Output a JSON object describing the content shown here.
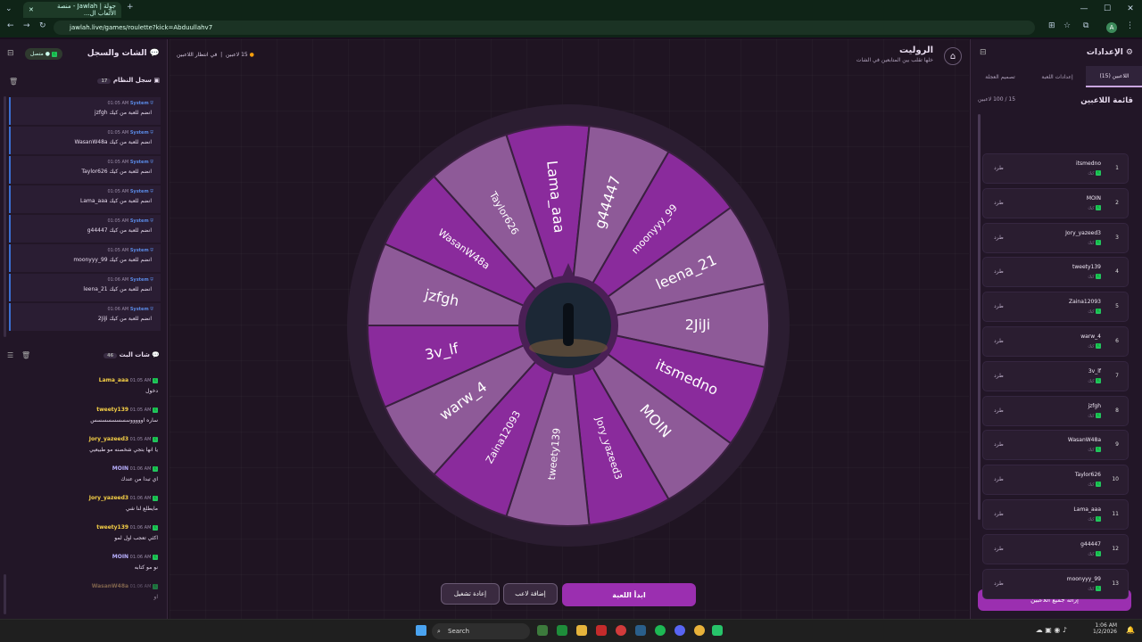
{
  "browser": {
    "tab_title": "جولة | Jawlah - منصة الألعاب ال...",
    "url": "jawlah.live/games/roulette?kick=Abduullahv7",
    "avatar_letter": "A"
  },
  "left": {
    "title": "الشات والسجل",
    "status": "متصل",
    "system_log_title": "سجل النظام",
    "system_log_count": "17",
    "system_log": [
      {
        "sender": "System",
        "time": "01:05 AM",
        "text": "jzfgh انضم للعبة من كيك"
      },
      {
        "sender": "System",
        "time": "01:05 AM",
        "text": "WasanW48a انضم للعبة من كيك"
      },
      {
        "sender": "System",
        "time": "01:05 AM",
        "text": "Taylor626 انضم للعبة من كيك"
      },
      {
        "sender": "System",
        "time": "01:05 AM",
        "text": "Lama_aaa انضم للعبة من كيك"
      },
      {
        "sender": "System",
        "time": "01:05 AM",
        "text": "g44447 انضم للعبة من كيك"
      },
      {
        "sender": "System",
        "time": "01:05 AM",
        "text": "moonyyy_99 انضم للعبة من كيك"
      },
      {
        "sender": "System",
        "time": "01:06 AM",
        "text": "leena_21 انضم للعبة من كيك"
      },
      {
        "sender": "System",
        "time": "01:06 AM",
        "text": "2JiJi انضم للعبة من كيك"
      }
    ],
    "live_chat_title": "شات البث",
    "live_chat_count": "46",
    "live_chat": [
      {
        "user": "Lama_aaa",
        "time": "01:05 AM",
        "text": "دخول",
        "color": "#f6d046"
      },
      {
        "user": "tweety139",
        "time": "01:05 AM",
        "text": "ساره اوووووسسسسسسسس",
        "color": "#f6d046"
      },
      {
        "user": "Jory_yazeed3",
        "time": "01:05 AM",
        "text": "يا انها بتجي شخصنه مو طبيعيي",
        "color": "#f6d046"
      },
      {
        "user": "MOIN",
        "time": "01:06 AM",
        "text": "اي تبدا من عندك",
        "color": "#b9b0ff"
      },
      {
        "user": "Jory_yazeed3",
        "time": "01:06 AM",
        "text": "مايطلع لنا شي",
        "color": "#f6d046"
      },
      {
        "user": "tweety139",
        "time": "01:06 AM",
        "text": "اكثي تعجب اول لمو",
        "color": "#f6d046"
      },
      {
        "user": "MOIN",
        "time": "01:06 AM",
        "text": "نو مو كتابه",
        "color": "#b9b0ff"
      },
      {
        "user": "WasanW48a",
        "time": "01:06 AM",
        "text": "او",
        "color": "#c9a06a"
      }
    ]
  },
  "header": {
    "title": "الروليت",
    "subtitle": "خلها تقلب بين المتابعين في الشات",
    "players_count": "15 لاعبين",
    "waiting": "في انتظار اللاعبين"
  },
  "wheel": {
    "segments": [
      "2JiJi",
      "itsmedno",
      "MOIN",
      "Jory_yazeed3",
      "tweety139",
      "Zaina12093",
      "warw_4",
      "3v_lf",
      "jzfgh",
      "WasanW48a",
      "Taylor626",
      "Lama_aaa",
      "g44447",
      "moonyyy_99",
      "leena_21"
    ],
    "colors": {
      "dark": "#8a2b9c",
      "light": "#8e5a98"
    }
  },
  "buttons": {
    "start": "ابدأ اللعبة",
    "add_player": "إضافة لاعب",
    "restart": "إعادة تشغيل"
  },
  "right": {
    "title": "الإعدادات",
    "tabs": [
      "اللاعبين (15)",
      "إعدادات اللعبة",
      "تصميم العجلة"
    ],
    "list_title": "قائمة اللاعبين",
    "list_count": "15 / 100 لاعبين",
    "players": [
      {
        "num": "1",
        "name": "itsmedno"
      },
      {
        "num": "2",
        "name": "MOIN"
      },
      {
        "num": "3",
        "name": "Jory_yazeed3"
      },
      {
        "num": "4",
        "name": "tweety139"
      },
      {
        "num": "5",
        "name": "Zaina12093"
      },
      {
        "num": "6",
        "name": "warw_4"
      },
      {
        "num": "7",
        "name": "3v_lf"
      },
      {
        "num": "8",
        "name": "jzfgh"
      },
      {
        "num": "9",
        "name": "WasanW48a"
      },
      {
        "num": "10",
        "name": "Taylor626"
      },
      {
        "num": "11",
        "name": "Lama_aaa"
      },
      {
        "num": "12",
        "name": "g44447"
      },
      {
        "num": "13",
        "name": "moonyyy_99"
      }
    ],
    "player_source": "كيك",
    "kick_label": "طرد",
    "remove_all": "إزالة جميع اللاعبين"
  },
  "taskbar": {
    "search": "Search",
    "time": "1:06 AM",
    "date": "1/2/2026"
  }
}
